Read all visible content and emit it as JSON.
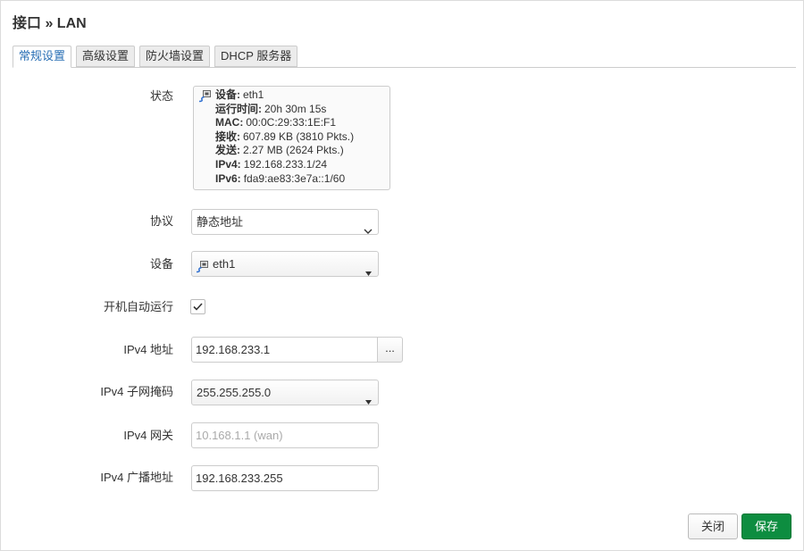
{
  "dialog": {
    "title": "接口 » LAN"
  },
  "tabs": [
    {
      "label": "常规设置",
      "active": true
    },
    {
      "label": "高级设置",
      "active": false
    },
    {
      "label": "防火墙设置",
      "active": false
    },
    {
      "label": "DHCP 服务器",
      "active": false
    }
  ],
  "status": {
    "label": "状态",
    "icon": "ethernet-port-icon",
    "rows": [
      {
        "key": "设备:",
        "value": "eth1"
      },
      {
        "key": "运行时间:",
        "value": "20h 30m 15s"
      },
      {
        "key": "MAC:",
        "value": "00:0C:29:33:1E:F1"
      },
      {
        "key": "接收:",
        "value": "607.89 KB (3810 Pkts.)"
      },
      {
        "key": "发送:",
        "value": "2.27 MB (2624 Pkts.)"
      },
      {
        "key": "IPv4:",
        "value": "192.168.233.1/24"
      },
      {
        "key": "IPv6:",
        "value": "fda9:ae83:3e7a::1/60"
      }
    ]
  },
  "fields": {
    "protocol": {
      "label": "协议",
      "value": "静态地址",
      "icon": "chevron-down-icon"
    },
    "device": {
      "label": "设备",
      "value": "eth1",
      "icon": "ethernet-port-icon"
    },
    "autostart": {
      "label": "开机自动运行",
      "checked": true
    },
    "ipv4_address": {
      "label": "IPv4 地址",
      "value": "192.168.233.1",
      "button_label": "..."
    },
    "ipv4_netmask": {
      "label": "IPv4 子网掩码",
      "value": "255.255.255.0"
    },
    "ipv4_gateway": {
      "label": "IPv4 网关",
      "placeholder": "10.168.1.1 (wan)"
    },
    "ipv4_broadcast": {
      "label": "IPv4 广播地址",
      "value": "192.168.233.255"
    }
  },
  "actions": {
    "close_label": "关闭",
    "save_label": "保存"
  },
  "colors": {
    "accent": "#2a6fb5",
    "save": "#0d8d40",
    "border": "#cccccc",
    "tab_inactive_bg": "#ececec"
  }
}
